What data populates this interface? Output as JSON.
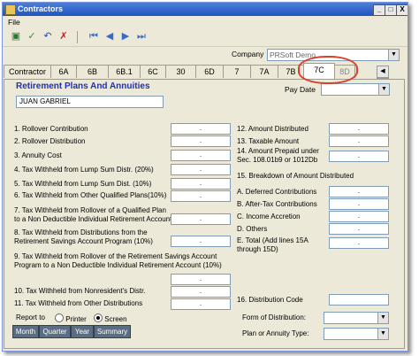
{
  "window": {
    "title": "Contractors",
    "min": "_",
    "max": "□",
    "close": "X"
  },
  "menu": {
    "file": "File"
  },
  "toolbar_icons": [
    "new-icon",
    "check-icon",
    "undo-icon",
    "delete-icon",
    "first-icon",
    "prev-icon",
    "next-icon",
    "last-icon"
  ],
  "company": {
    "label": "Company",
    "value": "PRSoft Demo"
  },
  "tabs": [
    "Contractor",
    "6A",
    "6B",
    "6B.1",
    "6C",
    "30",
    "6D",
    "7",
    "7A",
    "7B",
    "7C",
    "8D"
  ],
  "selected_tab": "7C",
  "section_title": "Retirement Plans And Annuities",
  "contractor_name": "JUAN GABRIEL",
  "pay_date": {
    "label": "Pay Date",
    "value": ""
  },
  "left_fields": [
    {
      "label": "1. Rollover Contribution",
      "value": "."
    },
    {
      "label": "2. Rollover Distribution",
      "value": "."
    },
    {
      "label": "3. Annuity Cost",
      "value": "."
    },
    {
      "label": "4. Tax Withheld from Lump Sum Distr. (20%)",
      "value": "."
    },
    {
      "label": "5. Tax Withheld from Lump Sum Dist. (10%)",
      "value": "."
    },
    {
      "label": "6. Tax Withheld from Other Qualified Plans(10%)",
      "value": "."
    },
    {
      "label": "7. Tax Withheld from Rollover of a Qualified Plan to a Non Deductible Individual  Retirement Account",
      "value": "."
    },
    {
      "label": "8. Tax Withheld from Distributions from the Retirement Savings Account Program (10%)",
      "value": "."
    },
    {
      "label": "9. Tax Withheld from Rollover of the Retirement Savings Account Program to a Non Deductible Individual Retirement Account (10%)",
      "value": "."
    },
    {
      "label": "10. Tax Withheld from Nonresident's Distr.",
      "value": "."
    },
    {
      "label": "11. Tax Withheld from Other Distributions",
      "value": "."
    }
  ],
  "right_fields": [
    {
      "label": "12. Amount Distributed",
      "value": "."
    },
    {
      "label": "13. Taxable Amount",
      "value": "."
    },
    {
      "label": "14. Amount Prepaid under Sec. 108.01b9 or 1012Db",
      "value": "."
    },
    {
      "label": "15.  Breakdown of Amount Distributed"
    },
    {
      "label": "A. Deferred Contributions",
      "value": "."
    },
    {
      "label": "B. After-Tax Contributions",
      "value": "."
    },
    {
      "label": "C. Income Accretion",
      "value": "."
    },
    {
      "label": "D. Others",
      "value": "."
    },
    {
      "label": "E. Total (Add lines 15A through 15D)",
      "value": "."
    },
    {
      "label": "16. Distribution Code",
      "value": ""
    },
    {
      "label": "Form of Distribution:",
      "value": ""
    },
    {
      "label": "Plan or Annuity Type:",
      "value": ""
    }
  ],
  "report": {
    "label": "Report to",
    "printer": "Printer",
    "screen": "Screen",
    "selected": "Screen",
    "buttons": [
      "Month",
      "Quarter",
      "Year",
      "Summary"
    ]
  },
  "colors": {
    "title_bar": "#1f54c0",
    "section_title": "#2030b0",
    "highlight_circle": "#d8402a",
    "report_button": "#5a6d82"
  }
}
